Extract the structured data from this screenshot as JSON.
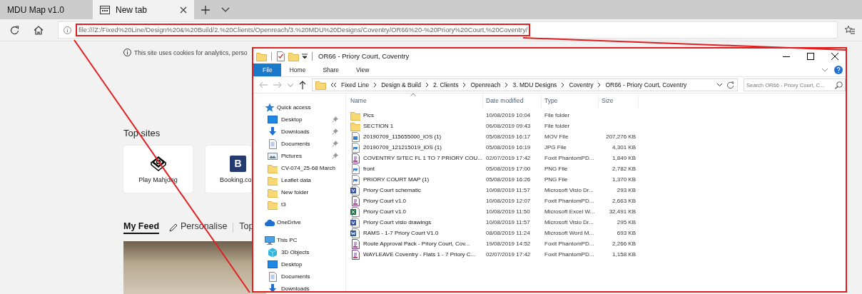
{
  "browser": {
    "tabs": [
      {
        "title": "MDU Map v1.0",
        "selected": false
      },
      {
        "title": "New tab",
        "selected": true
      }
    ],
    "address": {
      "url": "file:///Z:/Fixed%20Line/Design%20&%20Build/2.%20Clients/Openreach/3.%20MDU%20Designs/Coventry/OR66%20-%20Priory%20Court,%20Coventry/"
    }
  },
  "new_tab_page": {
    "notice": "This site uses cookies for analytics, perso",
    "top_sites_heading": "Top sites",
    "top_sites": [
      {
        "kind": "mahjong",
        "label": "Play Mahjong"
      },
      {
        "kind": "booking",
        "logo": "B",
        "label": "Booking.co"
      }
    ],
    "feed_bar": [
      {
        "kind": "tab",
        "label": "My Feed",
        "selected": true
      },
      {
        "kind": "action",
        "label": "Personalise",
        "selected": false
      },
      {
        "kind": "tab",
        "label": "Top",
        "selected": false
      }
    ]
  },
  "explorer": {
    "title": "OR66 - Priory Court, Coventry",
    "ribbon_tabs": [
      {
        "label": "File",
        "selected": true
      },
      {
        "label": "Home",
        "selected": false
      },
      {
        "label": "Share",
        "selected": false
      },
      {
        "label": "View",
        "selected": false
      }
    ],
    "breadcrumb": [
      "Fixed Line",
      "Design & Build",
      "2. Clients",
      "Openreach",
      "3. MDU Designs",
      "Coventry",
      "OR66 - Priory Court, Coventry"
    ],
    "search": {
      "placeholder": "Search OR66 - Priory Court, C..."
    },
    "nav_pane": [
      {
        "kind": "star",
        "label": "Quick access",
        "children": [
          {
            "kind": "desktop",
            "label": "Desktop",
            "pinned": true
          },
          {
            "kind": "download",
            "label": "Downloads",
            "pinned": true
          },
          {
            "kind": "documents",
            "label": "Documents",
            "pinned": true
          },
          {
            "kind": "pictures",
            "label": "Pictures",
            "pinned": true
          },
          {
            "kind": "folder",
            "label": "CV-074_25-68 March",
            "pinned": false
          },
          {
            "kind": "folder",
            "label": "Leaflet data",
            "pinned": false
          },
          {
            "kind": "folder",
            "label": "New folder",
            "pinned": false
          },
          {
            "kind": "folder",
            "label": "t3",
            "pinned": false
          }
        ]
      },
      {
        "kind": "cloud",
        "label": "OneDrive"
      },
      {
        "kind": "pc",
        "label": "This PC",
        "children": [
          {
            "kind": "cube",
            "label": "3D Objects",
            "pinned": false
          },
          {
            "kind": "desktop",
            "label": "Desktop",
            "pinned": false
          },
          {
            "kind": "documents",
            "label": "Documents",
            "pinned": false
          },
          {
            "kind": "download",
            "label": "Downloads",
            "pinned": false
          }
        ]
      }
    ],
    "columns": [
      "Name",
      "Date modified",
      "Type",
      "Size"
    ],
    "files": [
      {
        "kind": "folder",
        "name": "Pics",
        "date": "10/08/2019 10:04",
        "type": "File folder"
      },
      {
        "kind": "folder",
        "name": "SECTION 1",
        "date": "06/08/2019 09:43",
        "type": "File folder"
      },
      {
        "kind": "video",
        "name": "20190709_115655000_iOS (1)",
        "date": "05/08/2019 16:17",
        "type": "MOV File",
        "size": "207,276 KB"
      },
      {
        "kind": "image",
        "name": "20190709_121215019_iOS (1)",
        "date": "05/08/2019 16:19",
        "type": "JPG File",
        "size": "4,301 KB"
      },
      {
        "kind": "pdf",
        "name": "COVENTRY SITEC FL 1 TO 7 PRIORY COU...",
        "date": "02/07/2019 17:42",
        "type": "Foxit PhantomPD...",
        "size": "1,849 KB"
      },
      {
        "kind": "image",
        "name": "front",
        "date": "05/08/2019 17:00",
        "type": "PNG File",
        "size": "2,782 KB"
      },
      {
        "kind": "image",
        "name": "PRIORY COURT MAP (1)",
        "date": "05/08/2019 16:26",
        "type": "PNG File",
        "size": "1,370 KB"
      },
      {
        "kind": "visio",
        "name": "Priory Court schematic",
        "date": "10/08/2019 11:57",
        "type": "Microsoft Visio Dr...",
        "size": "293 KB"
      },
      {
        "kind": "pdf",
        "name": "Priory Court v1.0",
        "date": "10/08/2019 12:07",
        "type": "Foxit PhantomPD...",
        "size": "2,663 KB"
      },
      {
        "kind": "excel",
        "name": "Priory Court v1.0",
        "date": "10/08/2019 11:50",
        "type": "Microsoft Excel W...",
        "size": "32,491 KB"
      },
      {
        "kind": "visio",
        "name": "Priory Court visio drawings",
        "date": "10/08/2019 11:57",
        "type": "Microsoft Visio Dr...",
        "size": "295 KB"
      },
      {
        "kind": "word",
        "name": "RAMS -  1-7 Priory Court V1.0",
        "date": "08/08/2019 11:24",
        "type": "Microsoft Word M...",
        "size": "693 KB"
      },
      {
        "kind": "pdf",
        "name": "Route Approval Pack - Priory Court, Cov...",
        "date": "19/08/2019 14:52",
        "type": "Foxit PhantomPD...",
        "size": "2,266 KB"
      },
      {
        "kind": "pdf",
        "name": "WAYLEAVE Coventry - Flats 1 - 7 Priory C...",
        "date": "02/07/2019 17:42",
        "type": "Foxit PhantomPD...",
        "size": "1,158 KB"
      }
    ]
  }
}
